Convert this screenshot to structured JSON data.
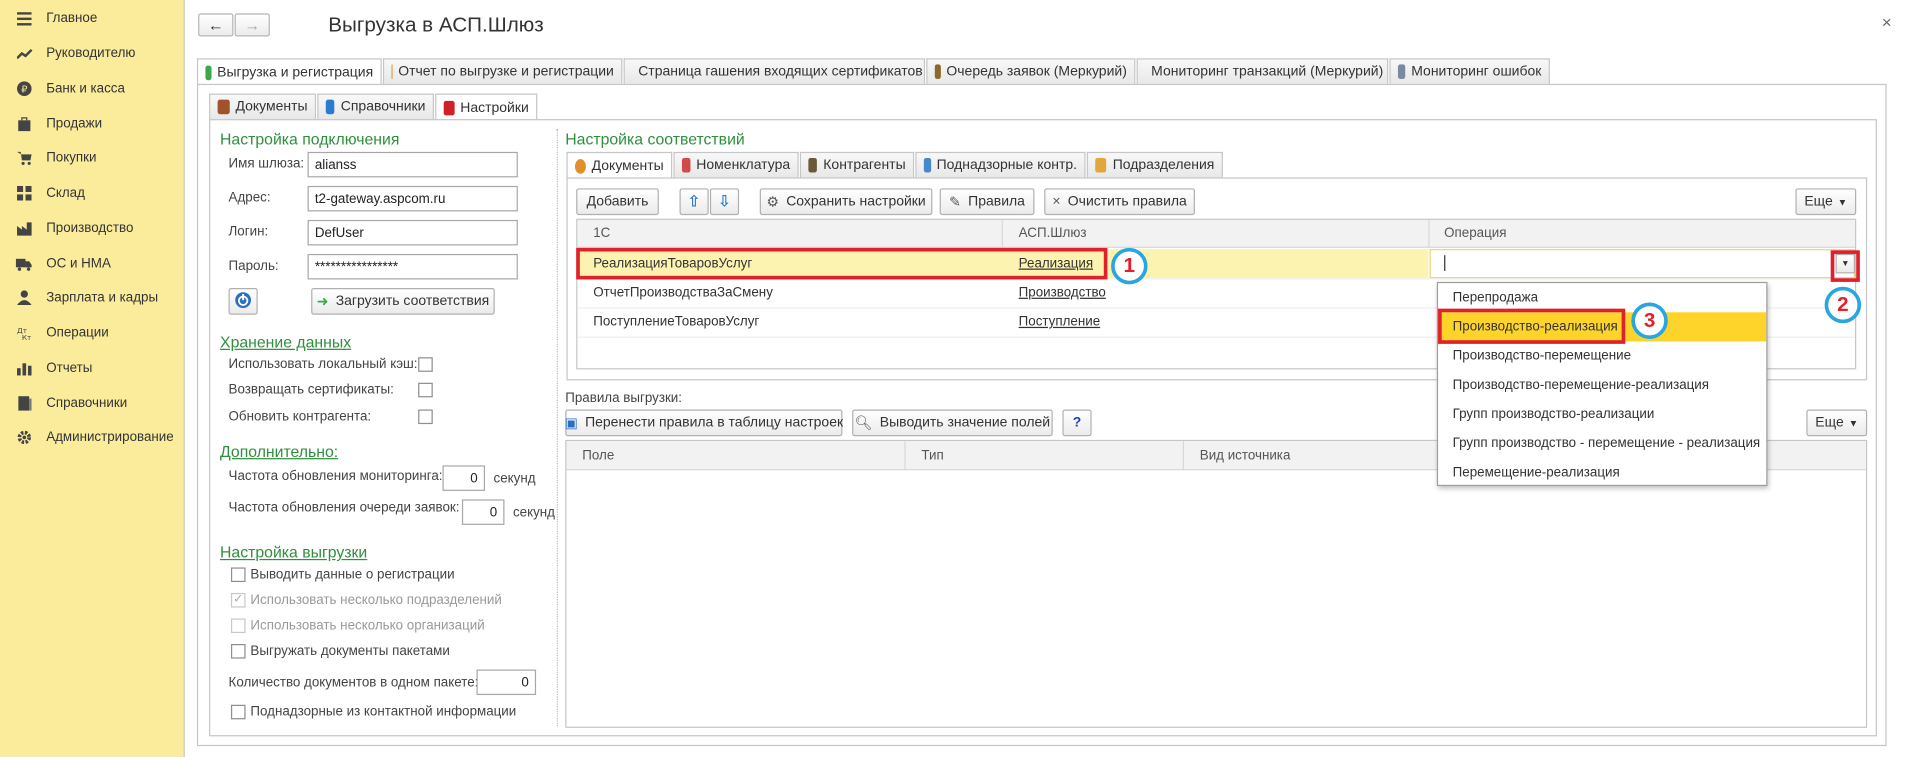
{
  "sidebar": {
    "items": [
      {
        "label": "Главное",
        "icon": "menu-icon"
      },
      {
        "label": "Руководителю",
        "icon": "trend-icon"
      },
      {
        "label": "Банк и касса",
        "icon": "coin-icon"
      },
      {
        "label": "Продажи",
        "icon": "bag-icon"
      },
      {
        "label": "Покупки",
        "icon": "cart-icon"
      },
      {
        "label": "Склад",
        "icon": "grid-icon"
      },
      {
        "label": "Производство",
        "icon": "factory-icon"
      },
      {
        "label": "ОС и НМА",
        "icon": "truck-icon"
      },
      {
        "label": "Зарплата и кадры",
        "icon": "person-icon"
      },
      {
        "label": "Операции",
        "icon": "operations-icon"
      },
      {
        "label": "Отчеты",
        "icon": "bar-chart-icon"
      },
      {
        "label": "Справочники",
        "icon": "book-icon"
      },
      {
        "label": "Администрирование",
        "icon": "gear-icon"
      }
    ]
  },
  "window": {
    "title": "Выгрузка в АСП.Шлюз",
    "back": "←",
    "forward": "→",
    "close": "×"
  },
  "main_tabs": [
    {
      "label": "Выгрузка и регистрация",
      "color": "#3aa84a"
    },
    {
      "label": "Отчет по выгрузке и регистрации",
      "color": "#e0a73a"
    },
    {
      "label": "Страница гашения входящих сертификатов",
      "color": "#4a86c8"
    },
    {
      "label": "Очередь заявок (Меркурий)",
      "color": "#8a6a2a"
    },
    {
      "label": "Мониторинг транзакций (Меркурий)",
      "color": "#e05a2a"
    },
    {
      "label": "Мониторинг ошибок",
      "color": "#7a8aa0"
    }
  ],
  "sub_tabs": [
    {
      "label": "Документы",
      "color": "#a0522d"
    },
    {
      "label": "Справочники",
      "color": "#2b7bd0"
    },
    {
      "label": "Настройки",
      "color": "#d0202a"
    }
  ],
  "connection": {
    "header": "Настройка подключения",
    "gateway_label": "Имя шлюза:",
    "gateway_value": "alianss",
    "address_label": "Адрес:",
    "address_value": "t2-gateway.aspcom.ru",
    "login_label": "Логин:",
    "login_value": "DefUser",
    "password_label": "Пароль:",
    "password_value": "****************",
    "load_button": "Загрузить соответствия"
  },
  "storage": {
    "header": "Хранение данных",
    "items": [
      "Использовать локальный кэш:",
      "Возвращать сертификаты:",
      "Обновить контрагента:"
    ]
  },
  "extra": {
    "header": "Дополнительно:",
    "monitor_label": "Частота обновления мониторинга:",
    "monitor_value": "0",
    "monitor_unit": "секунд",
    "queue_label": "Частота обновления очереди заявок:",
    "queue_value": "0",
    "queue_unit": "секунд"
  },
  "export_settings": {
    "header": "Настройка выгрузки",
    "items": [
      {
        "label": "Выводить данные о регистрации",
        "checked": false,
        "disabled": false
      },
      {
        "label": "Использовать несколько подразделений",
        "checked": true,
        "disabled": true
      },
      {
        "label": "Использовать несколько организаций",
        "checked": false,
        "disabled": true
      },
      {
        "label": "Выгружать документы пакетами",
        "checked": false,
        "disabled": false
      }
    ],
    "packet_label": "Количество документов в одном пакете:",
    "packet_value": "0",
    "supervised_label": "Поднадзорные из контактной информации"
  },
  "mapping": {
    "header": "Настройка соответствий",
    "tabs": [
      {
        "label": "Документы",
        "color": "#e0902a"
      },
      {
        "label": "Номенклатура",
        "color": "#d04a4a"
      },
      {
        "label": "Контрагенты",
        "color": "#6a5a3a"
      },
      {
        "label": "Поднадзорные контр.",
        "color": "#4a86c8"
      },
      {
        "label": "Подразделения",
        "color": "#e0a73a"
      }
    ],
    "toolbar": {
      "add": "Добавить",
      "up": "⇧",
      "down": "⇩",
      "save": "Сохранить настройки",
      "rules": "Правила",
      "clear": "Очистить правила",
      "more": "Еще"
    },
    "columns": [
      "1С",
      "АСП.Шлюз",
      "Операция"
    ],
    "rows": [
      {
        "c1": "РеализацияТоваровУслуг",
        "c2": "Реализация",
        "c3": ""
      },
      {
        "c1": "ОтчетПроизводстваЗаСмену",
        "c2": "Производство",
        "c3": ""
      },
      {
        "c1": "ПоступлениеТоваровУслуг",
        "c2": "Поступление",
        "c3": ""
      }
    ]
  },
  "dropdown": {
    "items": [
      "Перепродажа",
      "Производство-реализация",
      "Производство-перемещение",
      "Производство-перемещение-реализация",
      "Групп производство-реализации",
      "Групп производство - перемещение - реализация",
      "Перемещение-реализация"
    ],
    "selected_index": 1,
    "highlight_color": "#ffd42a"
  },
  "export_rules": {
    "header": "Правила выгрузки:",
    "transfer_button": "Перенести правила в таблицу настроек",
    "show_button": "Выводить значение полей",
    "help_button": "?",
    "more": "Еще",
    "columns": [
      "Поле",
      "Тип",
      "Вид источника"
    ]
  },
  "annotations": {
    "badge1": "1",
    "badge2": "2",
    "badge3": "3"
  },
  "colors": {
    "sidebar": "#fbec9c",
    "group_header": "#2f8f3d",
    "selected_row": "#fdf3b0",
    "annotation_red": "#e0202a",
    "annotation_blue": "#29a5e0"
  }
}
